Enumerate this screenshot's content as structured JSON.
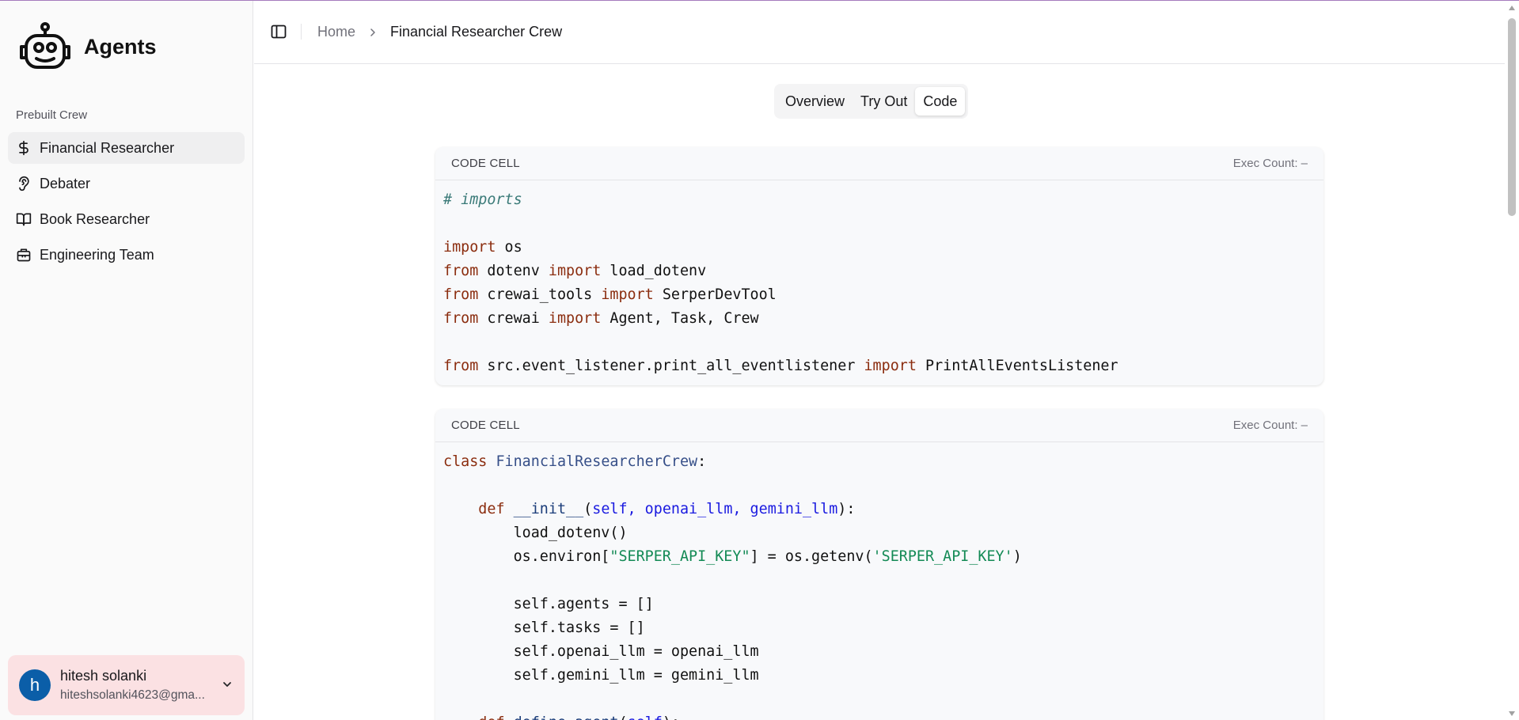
{
  "app": {
    "title": "Agents"
  },
  "sidebar": {
    "group_label": "Prebuilt Crew",
    "items": [
      {
        "label": "Financial Researcher",
        "icon": "dollar-icon",
        "active": true
      },
      {
        "label": "Debater",
        "icon": "ear-icon",
        "active": false
      },
      {
        "label": "Book Researcher",
        "icon": "book-open-icon",
        "active": false
      },
      {
        "label": "Engineering Team",
        "icon": "briefcase-icon",
        "active": false
      }
    ],
    "user": {
      "initial": "h",
      "name": "hitesh solanki",
      "email": "hiteshsolanki4623@gma..."
    }
  },
  "header": {
    "breadcrumb": {
      "home": "Home",
      "current": "Financial Researcher Crew"
    }
  },
  "tabs": [
    {
      "label": "Overview",
      "active": false
    },
    {
      "label": "Try Out",
      "active": false
    },
    {
      "label": "Code",
      "active": true
    }
  ],
  "cells": [
    {
      "label": "CODE CELL",
      "exec": "Exec Count: –",
      "lines": [
        [
          [
            "cm",
            "# imports"
          ]
        ],
        [],
        [
          [
            "kw",
            "import"
          ],
          [
            "",
            " os"
          ]
        ],
        [
          [
            "kw",
            "from"
          ],
          [
            "",
            " dotenv "
          ],
          [
            "kw",
            "import"
          ],
          [
            "",
            " load_dotenv"
          ]
        ],
        [
          [
            "kw",
            "from"
          ],
          [
            "",
            " crewai_tools "
          ],
          [
            "kw",
            "import"
          ],
          [
            "",
            " SerperDevTool"
          ]
        ],
        [
          [
            "kw",
            "from"
          ],
          [
            "",
            " crewai "
          ],
          [
            "kw",
            "import"
          ],
          [
            "",
            " Agent, Task, Crew"
          ]
        ],
        [],
        [
          [
            "kw",
            "from"
          ],
          [
            "",
            " src.event_listener.print_all_eventlistener "
          ],
          [
            "kw",
            "import"
          ],
          [
            "",
            " PrintAllEventsListener"
          ]
        ]
      ]
    },
    {
      "label": "CODE CELL",
      "exec": "Exec Count: –",
      "lines": [
        [
          [
            "kw",
            "class"
          ],
          [
            "",
            " "
          ],
          [
            "cls",
            "FinancialResearcherCrew"
          ],
          [
            "",
            ":"
          ]
        ],
        [],
        [
          [
            "",
            "    "
          ],
          [
            "kw",
            "def"
          ],
          [
            "",
            " "
          ],
          [
            "fn",
            "__init__"
          ],
          [
            "",
            "("
          ],
          [
            "par",
            "self, openai_llm, gemini_llm"
          ],
          [
            "",
            "):"
          ]
        ],
        [
          [
            "",
            "        load_dotenv()"
          ]
        ],
        [
          [
            "",
            "        os.environ["
          ],
          [
            "str",
            "\"SERPER_API_KEY\""
          ],
          [
            "",
            "] = os.getenv("
          ],
          [
            "str",
            "'SERPER_API_KEY'"
          ],
          [
            "",
            ")"
          ]
        ],
        [],
        [
          [
            "",
            "        self.agents = []"
          ]
        ],
        [
          [
            "",
            "        self.tasks = []"
          ]
        ],
        [
          [
            "",
            "        self.openai_llm = openai_llm"
          ]
        ],
        [
          [
            "",
            "        self.gemini_llm = gemini_llm"
          ]
        ],
        [],
        [
          [
            "",
            "    "
          ],
          [
            "kw",
            "def"
          ],
          [
            "",
            " "
          ],
          [
            "fn",
            "define_agent"
          ],
          [
            "",
            "("
          ],
          [
            "par",
            "self"
          ],
          [
            "",
            "):"
          ]
        ]
      ]
    }
  ],
  "colors": {
    "keyword": "#8b2d0f",
    "comment": "#3a7a78",
    "string": "#138a55",
    "avatar": "#0b5ea8",
    "user_card": "#fbe1e3"
  }
}
